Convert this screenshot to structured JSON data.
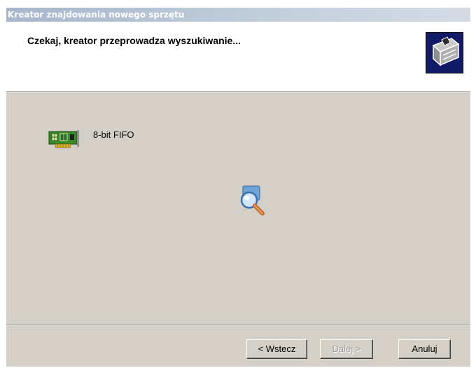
{
  "window": {
    "title": "Kreator znajdowania nowego sprzętu"
  },
  "header": {
    "title": "Czekaj, kreator przeprowadza wyszukiwanie...",
    "icon": "hardware-wizard-icon"
  },
  "content": {
    "device_name": "8-bit FIFO",
    "device_icon": "pci-card-icon",
    "progress_icon": "search-magnifier-icon"
  },
  "buttons": {
    "back_label": "< Wstecz",
    "next_label": "Dalej >",
    "next_enabled": false,
    "cancel_label": "Anuluj"
  }
}
